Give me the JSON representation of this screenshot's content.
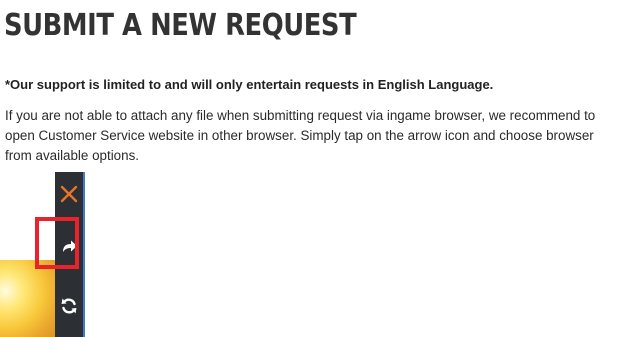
{
  "page": {
    "title": "SUBMIT A NEW REQUEST",
    "notice": "*Our support is limited to and will only entertain requests in English Language.",
    "instructions": "If you are not able to attach any file when submitting request via ingame browser, we recommend to open Customer Service website in other browser. Simply tap on the arrow icon and choose browser from available options."
  },
  "screenshot": {
    "icons": [
      "close-icon",
      "share-arrow-icon",
      "refresh-icon"
    ],
    "highlight_color": "#e8232b",
    "bar_color": "#2c2f33",
    "close_icon_color": "#e8742c"
  }
}
